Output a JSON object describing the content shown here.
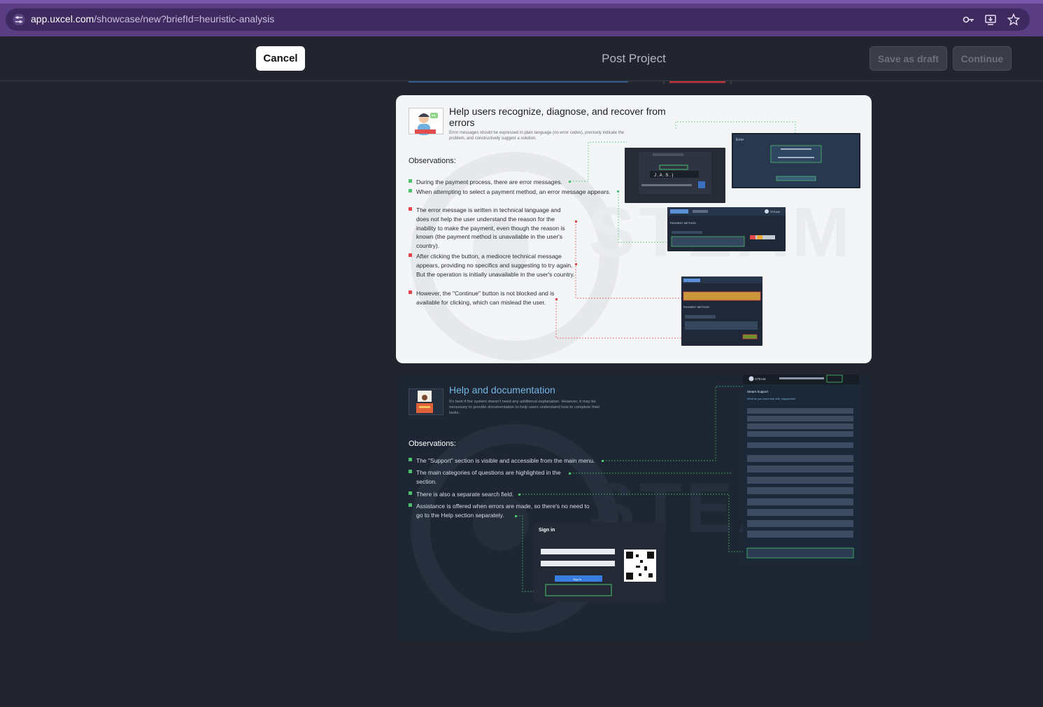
{
  "browser": {
    "url_host": "app.uxcel.com",
    "url_path": "/showcase/new?briefId=heuristic-analysis",
    "icons": [
      "tune-icon",
      "password-key-icon",
      "install-app-icon",
      "bookmark-star-icon"
    ]
  },
  "header": {
    "cancel_label": "Cancel",
    "title": "Post Project",
    "save_draft_label": "Save as draft",
    "continue_label": "Continue"
  },
  "card1": {
    "title": "Help users recognize, diagnose, and recover from errors",
    "description": "Error messages should be expressed in plain language (no error codes), precisely indicate the problem, and constructively suggest a solution.",
    "observations_title": "Observations:",
    "observations": [
      {
        "status": "positive",
        "text": "During the payment process, there are error messages."
      },
      {
        "status": "positive",
        "text": "When attempting to select a payment method, an error message appears."
      },
      {
        "status": "negative",
        "text": "The error message is written in technical language and does not help the user understand the reason for the inability to make the payment, even though the reason is known (the payment method is unavailable in the user's country)."
      },
      {
        "status": "negative",
        "text": "After clicking the button, a mediocre technical message appears, providing no specifics and suggesting to try again. But the operation is initially unavailable in the user's country."
      },
      {
        "status": "negative",
        "text": "However, the \"Continue\" button is not blocked and is available for clicking, which can mislead the user."
      }
    ],
    "watermark": "STEAM",
    "shot_labels": {
      "error_title": "Error",
      "payment_method": "PAYMENT METHOD",
      "steam": "STEAM"
    }
  },
  "card2": {
    "title": "Help and documentation",
    "description": "It's best if the system doesn't need any additional explanation. However, it may be necessary to provide documentation to help users understand how to complete their tasks.",
    "observations_title": "Observations:",
    "observations": [
      {
        "status": "positive",
        "text": "The \"Support\" section is visible and accessible from the main menu."
      },
      {
        "status": "positive",
        "text": "The main categories of questions are highlighted in the section."
      },
      {
        "status": "positive",
        "text": "There is also a separate search field."
      },
      {
        "status": "positive",
        "text": "Assistance is offered when errors are made, so there's no need to go to the Help section separately."
      }
    ],
    "watermark": "STEAM",
    "shot_labels": {
      "steam": "STEAM",
      "support_title": "Steam Support",
      "support_question": "What do you need help with, happymeta?",
      "sign_in": "Sign in",
      "sign_in_button": "Sign in"
    }
  },
  "colors": {
    "positive": "#4cc06f",
    "negative": "#e0444d",
    "browser_frame": "#5a3d82",
    "app_bg": "#22242e",
    "help_title": "#74b6e3"
  }
}
